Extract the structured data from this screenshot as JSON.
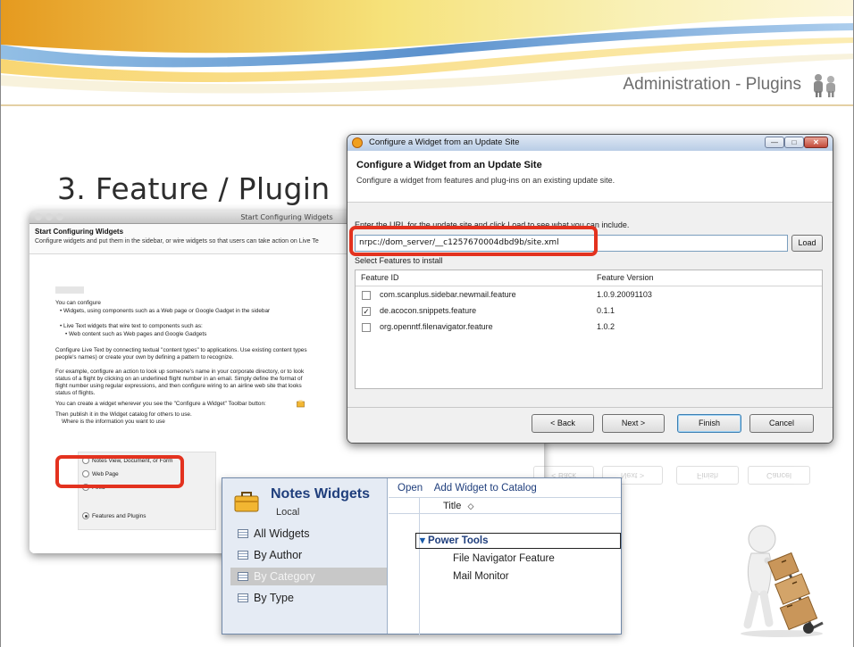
{
  "header": {
    "title": "Administration - Plugins",
    "icon": "people-icon"
  },
  "slide": {
    "title": "3. Feature / Plugin"
  },
  "left_screenshot": {
    "window_title": "Start Configuring Widgets",
    "heading": "Start Configuring Widgets",
    "subheading": "Configure widgets and put them in the sidebar, or wire widgets so that users can take action on Live Te",
    "lines": [
      "You can configure",
      "• Widgets, using components such as a Web page or Google Gadget in the sidebar",
      "• Live Text widgets that wire text to components such as:",
      "• Web content such as Web pages and Google Gadgets",
      "Configure Live Text by connecting textual \"content types\" to applications. Use existing content types",
      "people's names) or create your own by defining a pattern to recognize.",
      "For example, configure an action to look up someone's name in your corporate directory, or to look",
      "status of a flight by clicking on an underlined flight number in an email.  Simply define the format of",
      "flight number using regular expressions, and then configure wiring to an airline web site that looks",
      "status of flights.",
      "You can create a widget wherever you see the \"Configure a Widget\" Toolbar button:",
      "Then publish it in the Widget catalog for others to use.",
      "Where is the information you want to use"
    ],
    "options": [
      {
        "label": "Notes View, Document, or Form",
        "selected": false
      },
      {
        "label": "Web Page",
        "selected": false
      },
      {
        "label": "Feed",
        "selected": false
      },
      {
        "label": "Features and Plugins",
        "selected": true
      }
    ]
  },
  "dialog": {
    "window_title": "Configure a Widget from an Update Site",
    "heading": "Configure a Widget from an Update Site",
    "description": "Configure a widget from features and plug-ins on an existing update site.",
    "url_prompt": "Enter the URL for the update site and click Load to see what you can include.",
    "url_value": "nrpc://dom_server/__c1257670004dbd9b/site.xml",
    "load_label": "Load",
    "select_label": "Select Features to install",
    "columns": [
      "Feature ID",
      "Feature Version"
    ],
    "features": [
      {
        "id": "com.scanplus.sidebar.newmail.feature",
        "version": "1.0.9.20091103",
        "checked": false
      },
      {
        "id": "de.acocon.snippets.feature",
        "version": "0.1.1",
        "checked": true
      },
      {
        "id": "org.openntf.filenavigator.feature",
        "version": "1.0.2",
        "checked": false
      }
    ],
    "buttons": {
      "back": "< Back",
      "next": "Next >",
      "finish": "Finish",
      "cancel": "Cancel"
    },
    "window_buttons": {
      "minimize": "—",
      "maximize": "□",
      "close": "✕"
    }
  },
  "notes_widgets": {
    "title": "Notes Widgets",
    "location": "Local",
    "nav": [
      {
        "label": "All Widgets",
        "selected": false
      },
      {
        "label": "By Author",
        "selected": false
      },
      {
        "label": "By Category",
        "selected": true
      },
      {
        "label": "By Type",
        "selected": false
      }
    ],
    "toolbar": [
      "Open",
      "Add Widget to Catalog"
    ],
    "column_title": "Title",
    "sort_glyph": "◇",
    "category": "Power Tools",
    "expand_glyph": "▾",
    "rows": [
      "File Navigator Feature",
      "Mail Monitor"
    ]
  },
  "colors": {
    "highlight_red": "#e3321f",
    "notes_blue": "#1f3e7c"
  }
}
